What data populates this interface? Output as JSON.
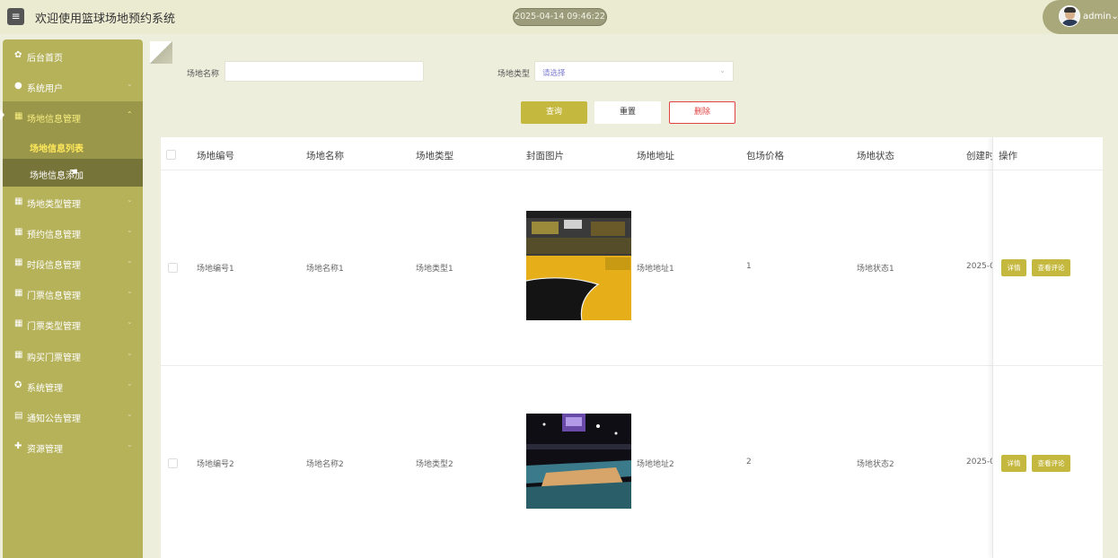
{
  "header": {
    "menu_icon": "menu-icon",
    "title": "欢迎使用篮球场地预约系统",
    "datetime": "2025-04-14 09:46:22",
    "user": "admin"
  },
  "sidebar": {
    "items": [
      {
        "label": "后台首页",
        "icon": "home-icon"
      },
      {
        "label": "系统用户",
        "icon": "user-icon"
      },
      {
        "label": "场地信息管理",
        "icon": "grid-icon"
      },
      {
        "label": "场地类型管理",
        "icon": "grid-icon"
      },
      {
        "label": "预约信息管理",
        "icon": "grid-icon"
      },
      {
        "label": "时段信息管理",
        "icon": "grid-icon"
      },
      {
        "label": "门票信息管理",
        "icon": "grid-icon"
      },
      {
        "label": "门票类型管理",
        "icon": "grid-icon"
      },
      {
        "label": "购买门票管理",
        "icon": "grid-icon"
      },
      {
        "label": "系统管理",
        "icon": "settings-icon"
      },
      {
        "label": "通知公告管理",
        "icon": "document-icon"
      },
      {
        "label": "资源管理",
        "icon": "plus-circle-icon"
      }
    ],
    "sub_items": [
      {
        "label": "场地信息列表"
      },
      {
        "label": "场地信息添加"
      }
    ]
  },
  "search": {
    "name_label": "场地名称",
    "name_value": "",
    "type_label": "场地类型",
    "type_placeholder": "请选择",
    "query_label": "查询",
    "reset_label": "重置",
    "delete_label": "删除"
  },
  "table": {
    "columns": [
      "场地编号",
      "场地名称",
      "场地类型",
      "封面图片",
      "场地地址",
      "包场价格",
      "场地状态",
      "创建时",
      "操作"
    ],
    "rows": [
      {
        "id": "场地编号1",
        "name": "场地名称1",
        "type": "场地类型1",
        "address": "场地地址1",
        "price": "1",
        "status": "场地状态1",
        "created": "2025-0",
        "detail": "详情",
        "review": "查看评论"
      },
      {
        "id": "场地编号2",
        "name": "场地名称2",
        "type": "场地类型2",
        "address": "场地地址2",
        "price": "2",
        "status": "场地状态2",
        "created": "2025-0",
        "detail": "详情",
        "review": "查看评论"
      }
    ]
  },
  "colors": {
    "accent": "#c5b83e",
    "sidebar": "#b5b25a",
    "sidebar_active": "#9a974a",
    "danger": "#e24141",
    "background": "#eeeedd"
  }
}
